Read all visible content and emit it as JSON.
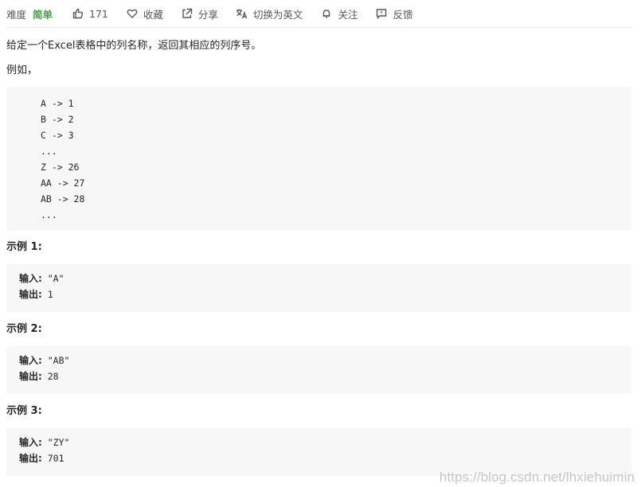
{
  "toolbar": {
    "difficulty_label": "难度",
    "difficulty_value": "简单",
    "difficulty_color": "#43a047",
    "like_count": "171",
    "favorite_label": "收藏",
    "share_label": "分享",
    "translate_label": "切换为英文",
    "follow_label": "关注",
    "feedback_label": "反馈",
    "icons": [
      "thumbs-up-icon",
      "heart-icon",
      "share-icon",
      "translate-icon",
      "bell-icon",
      "feedback-icon"
    ]
  },
  "problem": {
    "description": "给定一个Excel表格中的列名称，返回其相应的列序号。",
    "example_intro": "例如，",
    "mapping_lines": [
      "A -> 1",
      "B -> 2",
      "C -> 3",
      "...",
      "Z -> 26",
      "AA -> 27",
      "AB -> 28",
      "..."
    ]
  },
  "examples": [
    {
      "heading": "示例 1:",
      "input_label": "输入:",
      "input_value": " \"A\"",
      "output_label": "输出:",
      "output_value": " 1"
    },
    {
      "heading": "示例 2:",
      "input_label": "输入:",
      "input_value": " \"AB\"",
      "output_label": "输出:",
      "output_value": " 28"
    },
    {
      "heading": "示例 3:",
      "input_label": "输入:",
      "input_value": " \"ZY\"",
      "output_label": "输出:",
      "output_value": " 701"
    }
  ],
  "watermark": "https://blog.csdn.net/lhxiehuimin"
}
